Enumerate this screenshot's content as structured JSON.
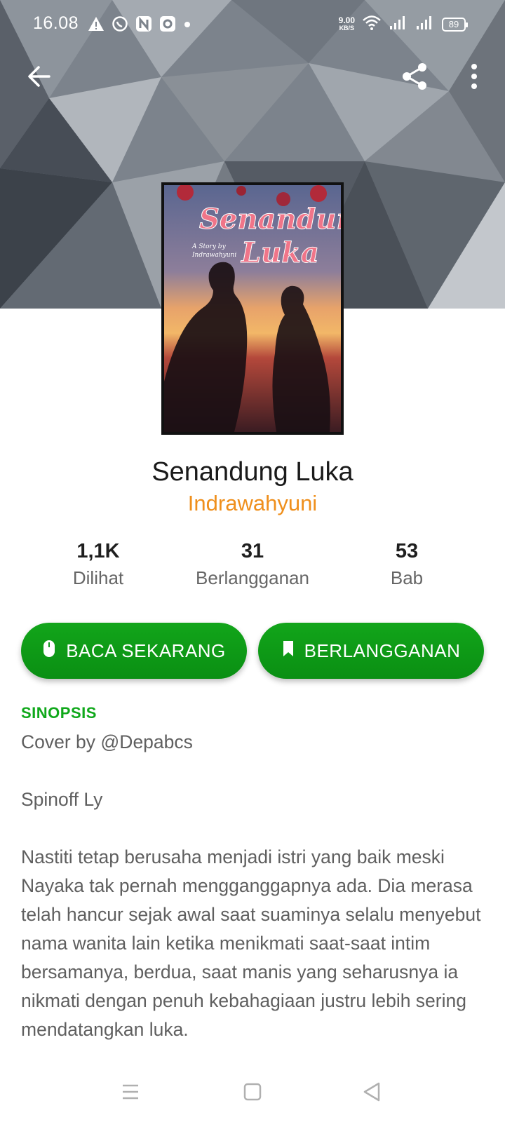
{
  "status_bar": {
    "time": "16.08",
    "net_speed_value": "9.00",
    "net_speed_unit": "KB/S",
    "battery": "89",
    "icons_left": [
      "warning-icon",
      "whatsapp-icon",
      "n-app-icon",
      "camera-app-icon",
      "dot-icon"
    ],
    "icons_right": [
      "wifi-icon",
      "signal-icon",
      "signal-icon",
      "battery-icon"
    ]
  },
  "toolbar": {
    "back_icon": "arrow-left-icon",
    "share_icon": "share-icon",
    "more_icon": "more-vertical-icon"
  },
  "cover": {
    "title_line1": "Senandung",
    "title_line2": "Luka",
    "byline1": "A Story by",
    "byline2": "Indrawahyuni"
  },
  "book": {
    "title": "Senandung Luka",
    "author": "Indrawahyuni"
  },
  "stats": [
    {
      "value": "1,1K",
      "label": "Dilihat"
    },
    {
      "value": "31",
      "label": "Berlangganan"
    },
    {
      "value": "53",
      "label": "Bab"
    }
  ],
  "actions": {
    "read_label": "BACA SEKARANG",
    "subscribe_label": "BERLANGGANAN"
  },
  "synopsis": {
    "heading": "SINOPSIS",
    "text": "Cover by @Depabcs\n\nSpinoff Ly\n\nNastiti tetap berusaha menjadi istri yang baik meski Nayaka tak pernah mengganggapnya ada. Dia merasa telah hancur sejak awal saat suaminya selalu menyebut nama wanita lain ketika menikmati saat-saat intim bersamanya, berdua, saat manis yang seharusnya ia nikmati dengan penuh kebahagiaan justru lebih sering mendatangkan luka."
  },
  "colors": {
    "accent_green": "#10a81b",
    "author_orange": "#ef8f1c"
  }
}
